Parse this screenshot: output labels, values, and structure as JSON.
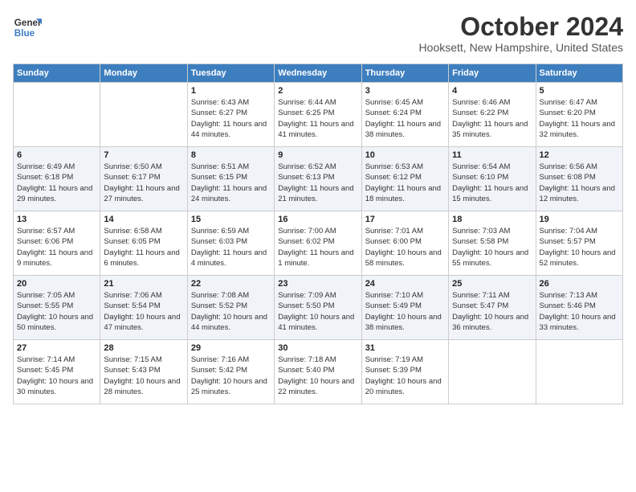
{
  "header": {
    "logo_line1": "General",
    "logo_line2": "Blue",
    "month": "October 2024",
    "location": "Hooksett, New Hampshire, United States"
  },
  "days_of_week": [
    "Sunday",
    "Monday",
    "Tuesday",
    "Wednesday",
    "Thursday",
    "Friday",
    "Saturday"
  ],
  "weeks": [
    [
      {
        "day": "",
        "sunrise": "",
        "sunset": "",
        "daylight": ""
      },
      {
        "day": "",
        "sunrise": "",
        "sunset": "",
        "daylight": ""
      },
      {
        "day": "1",
        "sunrise": "Sunrise: 6:43 AM",
        "sunset": "Sunset: 6:27 PM",
        "daylight": "Daylight: 11 hours and 44 minutes."
      },
      {
        "day": "2",
        "sunrise": "Sunrise: 6:44 AM",
        "sunset": "Sunset: 6:25 PM",
        "daylight": "Daylight: 11 hours and 41 minutes."
      },
      {
        "day": "3",
        "sunrise": "Sunrise: 6:45 AM",
        "sunset": "Sunset: 6:24 PM",
        "daylight": "Daylight: 11 hours and 38 minutes."
      },
      {
        "day": "4",
        "sunrise": "Sunrise: 6:46 AM",
        "sunset": "Sunset: 6:22 PM",
        "daylight": "Daylight: 11 hours and 35 minutes."
      },
      {
        "day": "5",
        "sunrise": "Sunrise: 6:47 AM",
        "sunset": "Sunset: 6:20 PM",
        "daylight": "Daylight: 11 hours and 32 minutes."
      }
    ],
    [
      {
        "day": "6",
        "sunrise": "Sunrise: 6:49 AM",
        "sunset": "Sunset: 6:18 PM",
        "daylight": "Daylight: 11 hours and 29 minutes."
      },
      {
        "day": "7",
        "sunrise": "Sunrise: 6:50 AM",
        "sunset": "Sunset: 6:17 PM",
        "daylight": "Daylight: 11 hours and 27 minutes."
      },
      {
        "day": "8",
        "sunrise": "Sunrise: 6:51 AM",
        "sunset": "Sunset: 6:15 PM",
        "daylight": "Daylight: 11 hours and 24 minutes."
      },
      {
        "day": "9",
        "sunrise": "Sunrise: 6:52 AM",
        "sunset": "Sunset: 6:13 PM",
        "daylight": "Daylight: 11 hours and 21 minutes."
      },
      {
        "day": "10",
        "sunrise": "Sunrise: 6:53 AM",
        "sunset": "Sunset: 6:12 PM",
        "daylight": "Daylight: 11 hours and 18 minutes."
      },
      {
        "day": "11",
        "sunrise": "Sunrise: 6:54 AM",
        "sunset": "Sunset: 6:10 PM",
        "daylight": "Daylight: 11 hours and 15 minutes."
      },
      {
        "day": "12",
        "sunrise": "Sunrise: 6:56 AM",
        "sunset": "Sunset: 6:08 PM",
        "daylight": "Daylight: 11 hours and 12 minutes."
      }
    ],
    [
      {
        "day": "13",
        "sunrise": "Sunrise: 6:57 AM",
        "sunset": "Sunset: 6:06 PM",
        "daylight": "Daylight: 11 hours and 9 minutes."
      },
      {
        "day": "14",
        "sunrise": "Sunrise: 6:58 AM",
        "sunset": "Sunset: 6:05 PM",
        "daylight": "Daylight: 11 hours and 6 minutes."
      },
      {
        "day": "15",
        "sunrise": "Sunrise: 6:59 AM",
        "sunset": "Sunset: 6:03 PM",
        "daylight": "Daylight: 11 hours and 4 minutes."
      },
      {
        "day": "16",
        "sunrise": "Sunrise: 7:00 AM",
        "sunset": "Sunset: 6:02 PM",
        "daylight": "Daylight: 11 hours and 1 minute."
      },
      {
        "day": "17",
        "sunrise": "Sunrise: 7:01 AM",
        "sunset": "Sunset: 6:00 PM",
        "daylight": "Daylight: 10 hours and 58 minutes."
      },
      {
        "day": "18",
        "sunrise": "Sunrise: 7:03 AM",
        "sunset": "Sunset: 5:58 PM",
        "daylight": "Daylight: 10 hours and 55 minutes."
      },
      {
        "day": "19",
        "sunrise": "Sunrise: 7:04 AM",
        "sunset": "Sunset: 5:57 PM",
        "daylight": "Daylight: 10 hours and 52 minutes."
      }
    ],
    [
      {
        "day": "20",
        "sunrise": "Sunrise: 7:05 AM",
        "sunset": "Sunset: 5:55 PM",
        "daylight": "Daylight: 10 hours and 50 minutes."
      },
      {
        "day": "21",
        "sunrise": "Sunrise: 7:06 AM",
        "sunset": "Sunset: 5:54 PM",
        "daylight": "Daylight: 10 hours and 47 minutes."
      },
      {
        "day": "22",
        "sunrise": "Sunrise: 7:08 AM",
        "sunset": "Sunset: 5:52 PM",
        "daylight": "Daylight: 10 hours and 44 minutes."
      },
      {
        "day": "23",
        "sunrise": "Sunrise: 7:09 AM",
        "sunset": "Sunset: 5:50 PM",
        "daylight": "Daylight: 10 hours and 41 minutes."
      },
      {
        "day": "24",
        "sunrise": "Sunrise: 7:10 AM",
        "sunset": "Sunset: 5:49 PM",
        "daylight": "Daylight: 10 hours and 38 minutes."
      },
      {
        "day": "25",
        "sunrise": "Sunrise: 7:11 AM",
        "sunset": "Sunset: 5:47 PM",
        "daylight": "Daylight: 10 hours and 36 minutes."
      },
      {
        "day": "26",
        "sunrise": "Sunrise: 7:13 AM",
        "sunset": "Sunset: 5:46 PM",
        "daylight": "Daylight: 10 hours and 33 minutes."
      }
    ],
    [
      {
        "day": "27",
        "sunrise": "Sunrise: 7:14 AM",
        "sunset": "Sunset: 5:45 PM",
        "daylight": "Daylight: 10 hours and 30 minutes."
      },
      {
        "day": "28",
        "sunrise": "Sunrise: 7:15 AM",
        "sunset": "Sunset: 5:43 PM",
        "daylight": "Daylight: 10 hours and 28 minutes."
      },
      {
        "day": "29",
        "sunrise": "Sunrise: 7:16 AM",
        "sunset": "Sunset: 5:42 PM",
        "daylight": "Daylight: 10 hours and 25 minutes."
      },
      {
        "day": "30",
        "sunrise": "Sunrise: 7:18 AM",
        "sunset": "Sunset: 5:40 PM",
        "daylight": "Daylight: 10 hours and 22 minutes."
      },
      {
        "day": "31",
        "sunrise": "Sunrise: 7:19 AM",
        "sunset": "Sunset: 5:39 PM",
        "daylight": "Daylight: 10 hours and 20 minutes."
      },
      {
        "day": "",
        "sunrise": "",
        "sunset": "",
        "daylight": ""
      },
      {
        "day": "",
        "sunrise": "",
        "sunset": "",
        "daylight": ""
      }
    ]
  ]
}
